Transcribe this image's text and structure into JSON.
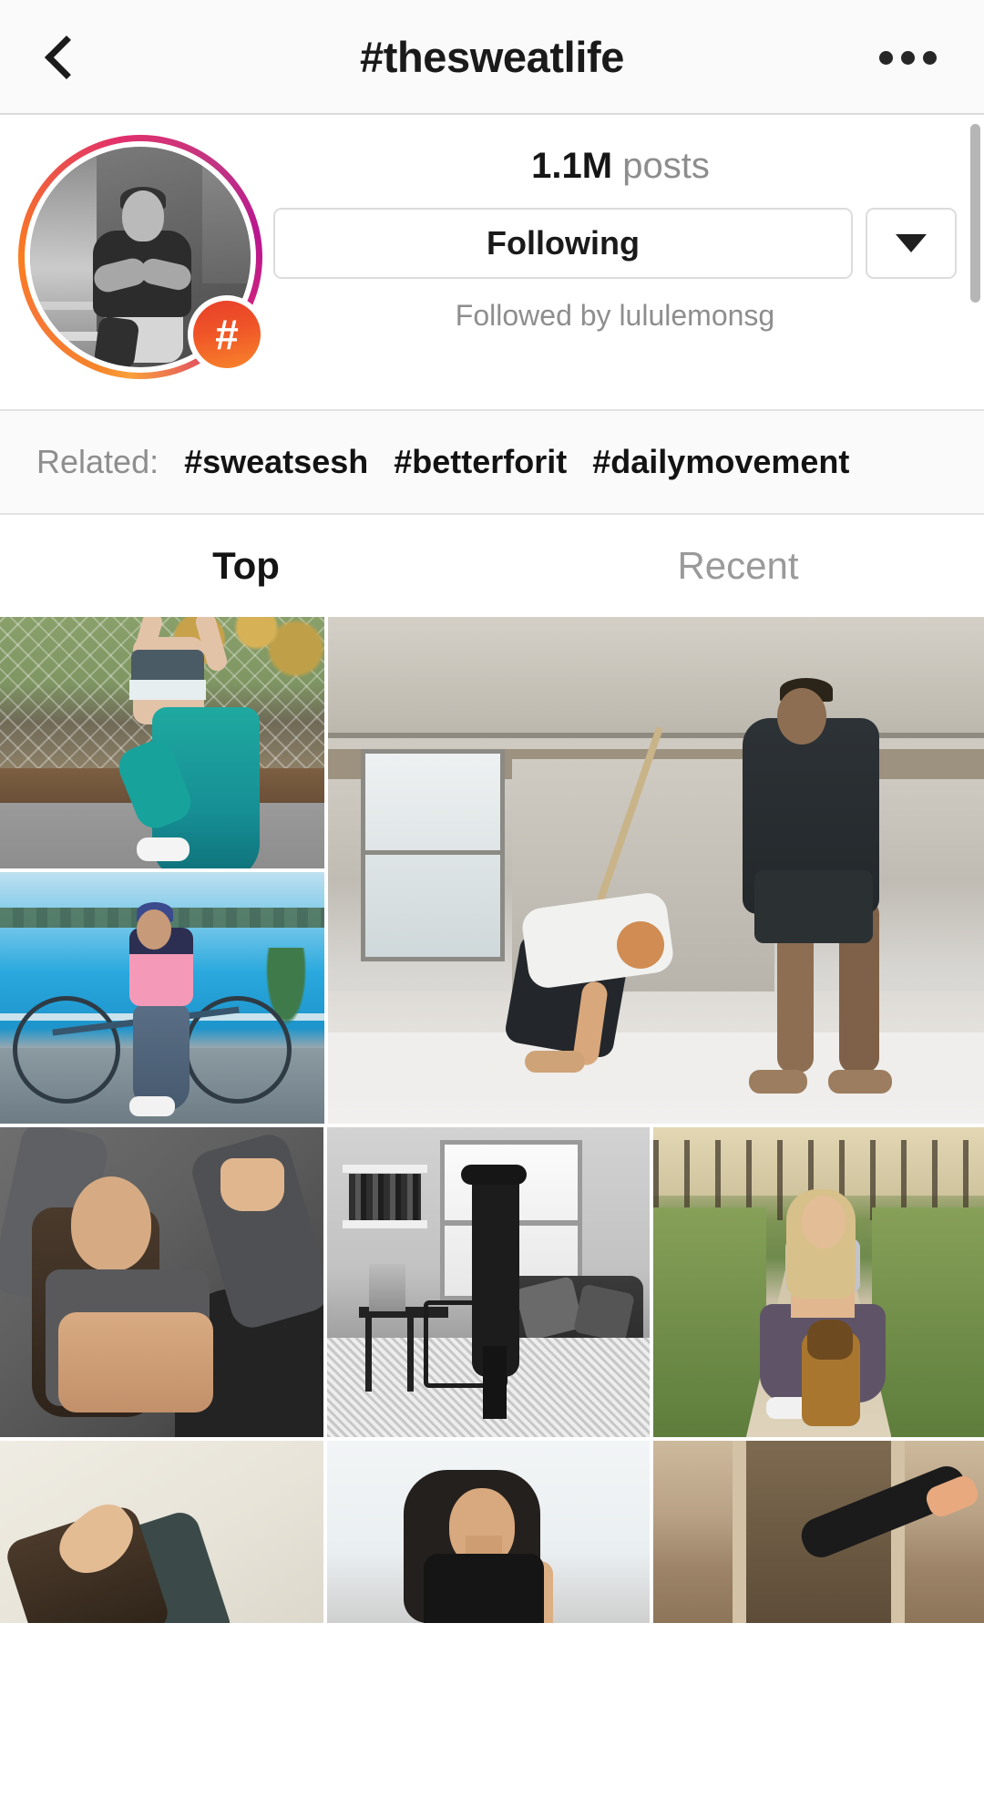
{
  "header": {
    "title": "#thesweatlife",
    "back_icon": "chevron-left-icon",
    "more_icon": "more-options-icon"
  },
  "profile": {
    "avatar_icon": "hashtag-avatar",
    "badge_glyph": "#",
    "posts_count": "1.1M",
    "posts_label": "posts",
    "follow_button": "Following",
    "dropdown_icon": "chevron-down-icon",
    "followed_by": "Followed by lululemonsg"
  },
  "related": {
    "label": "Related:",
    "tags": [
      "#sweatsesh",
      "#betterforit",
      "#dailymovement"
    ]
  },
  "tabs": [
    {
      "label": "Top",
      "active": true
    },
    {
      "label": "Recent",
      "active": false
    }
  ],
  "grid": {
    "tiles": [
      {
        "name": "post-runner-fence",
        "alt": "Woman in teal leggings stretching by a chain-link fence"
      },
      {
        "name": "post-cyclist-lake",
        "alt": "Woman with a bicycle on a pier by blue water"
      },
      {
        "name": "post-gym-rope-featured",
        "alt": "Two people training with a rope in an industrial gym"
      },
      {
        "name": "post-stretch-gray",
        "alt": "Woman stretching against a gray backdrop"
      },
      {
        "name": "post-livingroom-yoga",
        "alt": "Black and white living room yoga pose"
      },
      {
        "name": "post-dog-path",
        "alt": "Woman kneeling with a dog on a gravel path"
      },
      {
        "name": "post-backbend",
        "alt": "Woman in a backbend on a cream background"
      },
      {
        "name": "post-portrait-black-top",
        "alt": "Woman in a black tank top portrait"
      },
      {
        "name": "post-doorway-kick",
        "alt": "Leg kick in a stone doorway"
      }
    ]
  }
}
